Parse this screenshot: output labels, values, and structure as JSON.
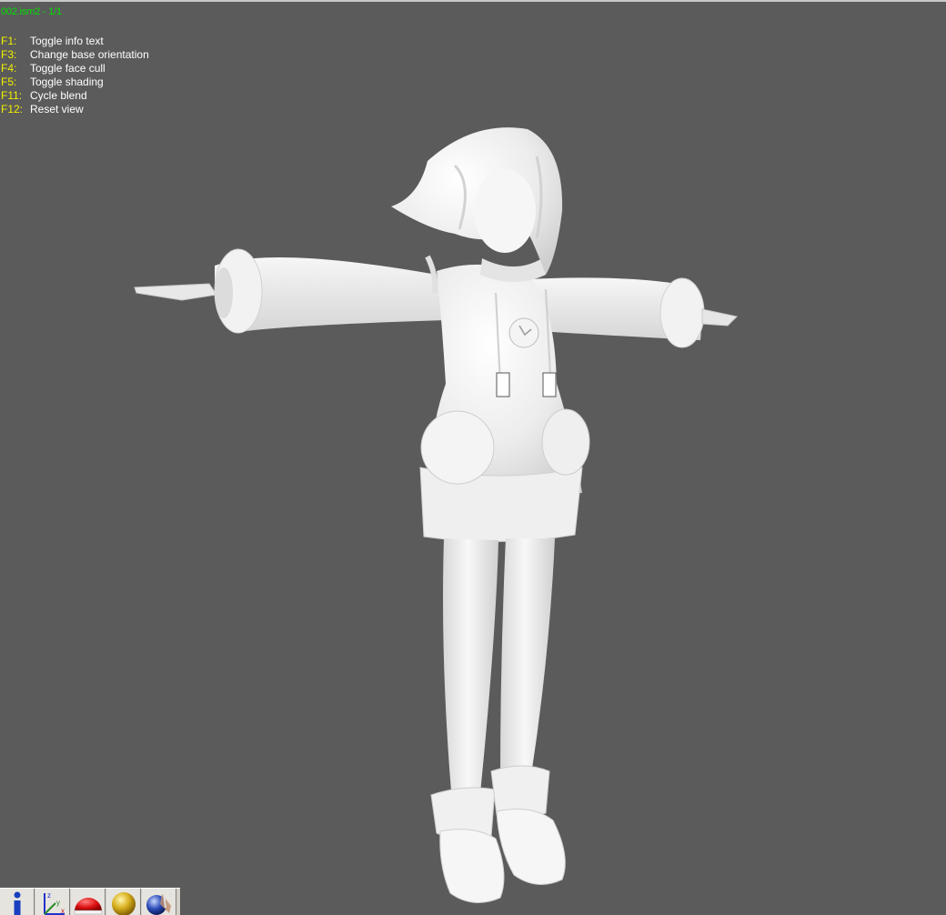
{
  "viewer": {
    "title": "002.ism2 - 1/1",
    "background_color": "#5b5b5b",
    "title_color": "#00e000",
    "key_color": "#f0f000"
  },
  "help": [
    {
      "key": "F1:",
      "desc": "Toggle info text"
    },
    {
      "key": "F3:",
      "desc": "Change base orientation"
    },
    {
      "key": "F4:",
      "desc": "Toggle face cull"
    },
    {
      "key": "F5:",
      "desc": "Toggle shading"
    },
    {
      "key": "F11:",
      "desc": "Cycle blend"
    },
    {
      "key": "F12:",
      "desc": "Reset view"
    }
  ],
  "toolbar": {
    "buttons": [
      {
        "icon": "info-icon"
      },
      {
        "icon": "axes-icon"
      },
      {
        "icon": "red-dome-icon"
      },
      {
        "icon": "gold-sphere-icon"
      },
      {
        "icon": "material-sphere-icon"
      }
    ],
    "axis_labels": {
      "x": "x",
      "y": "y",
      "z": "z"
    }
  }
}
